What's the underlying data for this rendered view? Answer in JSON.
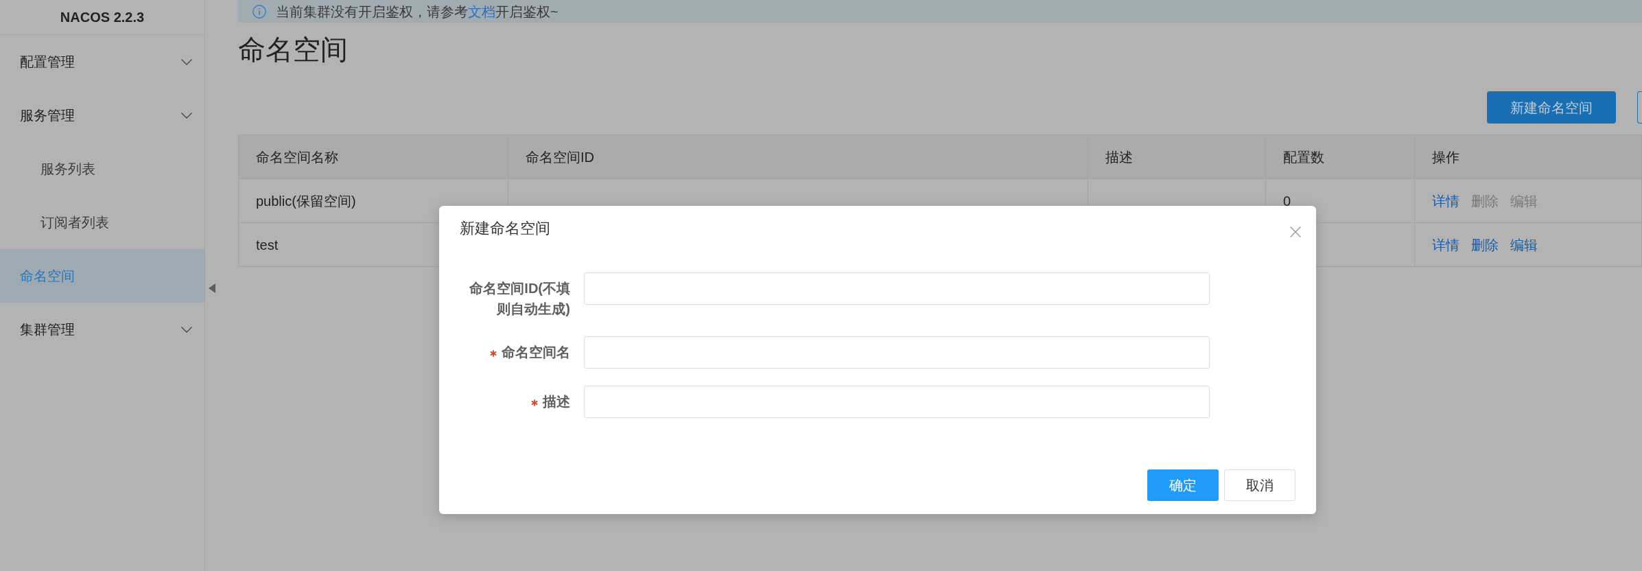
{
  "sidebar": {
    "logo": "NACOS 2.2.3",
    "items": [
      {
        "label": "配置管理",
        "kind": "group",
        "selected": false
      },
      {
        "label": "服务管理",
        "kind": "group",
        "selected": false,
        "children": [
          {
            "label": "服务列表",
            "selected": false
          },
          {
            "label": "订阅者列表",
            "selected": false
          }
        ]
      },
      {
        "label": "命名空间",
        "kind": "link",
        "selected": true
      },
      {
        "label": "集群管理",
        "kind": "group",
        "selected": false
      }
    ]
  },
  "notice": {
    "parts": [
      {
        "kind": "text",
        "text": "当前集群没有开启鉴权，请参考"
      },
      {
        "kind": "link",
        "text": "文档"
      },
      {
        "kind": "text",
        "text": "开启鉴权~"
      }
    ]
  },
  "page_title": "命名空间",
  "toolbar": {
    "buttons": [
      {
        "kind": "primary",
        "label": "新建命名空间"
      },
      {
        "kind": "outline"
      }
    ]
  },
  "table": {
    "columns": [
      "命名空间名称",
      "命名空间ID",
      "描述",
      "配置数",
      "操作"
    ],
    "rows": [
      {
        "name": "public(保留空间)",
        "config_count": "0",
        "actions": [
          {
            "label": "详情",
            "disabled": false
          },
          {
            "label": "删除",
            "disabled": true
          },
          {
            "label": "编辑",
            "disabled": true
          }
        ]
      },
      {
        "name": "test",
        "actions": [
          {
            "label": "详情",
            "disabled": false
          },
          {
            "label": "删除",
            "disabled": false
          },
          {
            "label": "编辑",
            "disabled": false
          }
        ]
      }
    ]
  },
  "dialog": {
    "title": "新建命名空间",
    "fields": [
      {
        "label": "命名空间ID(不填则自动生成)",
        "required": false
      },
      {
        "label": "命名空间名",
        "required": true
      },
      {
        "label": "描述",
        "required": true
      }
    ],
    "buttons": [
      {
        "kind": "primary",
        "label": "确定"
      },
      {
        "kind": "secondary",
        "label": "取消"
      }
    ]
  }
}
